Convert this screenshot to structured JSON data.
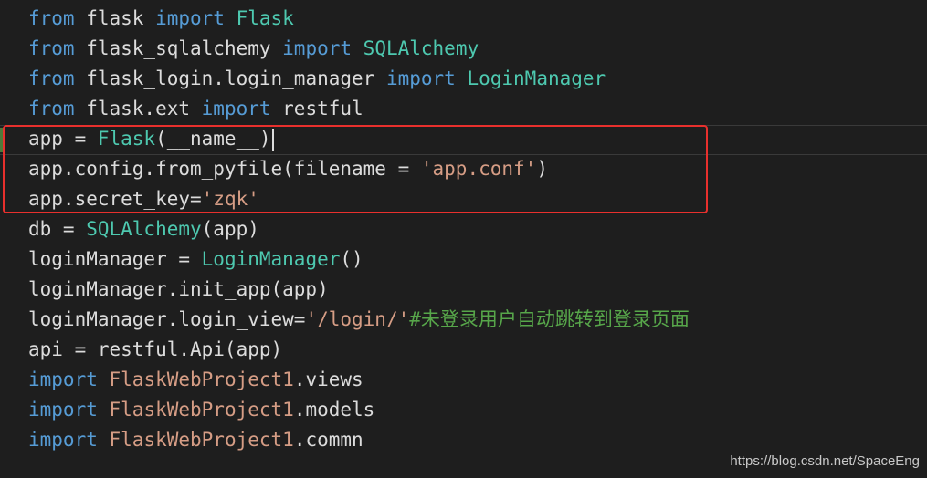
{
  "lines": [
    [
      {
        "t": "from",
        "c": "kw"
      },
      {
        "t": " flask ",
        "c": "plain"
      },
      {
        "t": "import",
        "c": "kw"
      },
      {
        "t": " ",
        "c": "plain"
      },
      {
        "t": "Flask",
        "c": "cls"
      }
    ],
    [
      {
        "t": "from",
        "c": "kw"
      },
      {
        "t": " flask_sqlalchemy ",
        "c": "plain"
      },
      {
        "t": "import",
        "c": "kw"
      },
      {
        "t": " ",
        "c": "plain"
      },
      {
        "t": "SQLAlchemy",
        "c": "cls"
      }
    ],
    [
      {
        "t": "from",
        "c": "kw"
      },
      {
        "t": " flask_login.login_manager ",
        "c": "plain"
      },
      {
        "t": "import",
        "c": "kw"
      },
      {
        "t": " ",
        "c": "plain"
      },
      {
        "t": "LoginManager",
        "c": "cls"
      }
    ],
    [
      {
        "t": "from",
        "c": "kw"
      },
      {
        "t": " flask.ext ",
        "c": "plain"
      },
      {
        "t": "import",
        "c": "kw"
      },
      {
        "t": " restful",
        "c": "plain"
      }
    ],
    [
      {
        "t": "app = ",
        "c": "plain"
      },
      {
        "t": "Flask",
        "c": "cls"
      },
      {
        "t": "(__name__)",
        "c": "plain"
      }
    ],
    [
      {
        "t": "app.config.from_pyfile(filename = ",
        "c": "plain"
      },
      {
        "t": "'app.conf'",
        "c": "str"
      },
      {
        "t": ")",
        "c": "plain"
      }
    ],
    [
      {
        "t": "app.secret_key=",
        "c": "plain"
      },
      {
        "t": "'zqk'",
        "c": "str"
      }
    ],
    [
      {
        "t": "db = ",
        "c": "plain"
      },
      {
        "t": "SQLAlchemy",
        "c": "cls"
      },
      {
        "t": "(app)",
        "c": "plain"
      }
    ],
    [
      {
        "t": "loginManager = ",
        "c": "plain"
      },
      {
        "t": "LoginManager",
        "c": "cls"
      },
      {
        "t": "()",
        "c": "plain"
      }
    ],
    [
      {
        "t": "loginManager.init_app(app)",
        "c": "plain"
      }
    ],
    [
      {
        "t": "loginManager.login_view=",
        "c": "plain"
      },
      {
        "t": "'/login/'",
        "c": "str"
      },
      {
        "t": "#未登录用户自动跳转到登录页面",
        "c": "cmt"
      }
    ],
    [
      {
        "t": "api = restful.Api(app)",
        "c": "plain"
      }
    ],
    [
      {
        "t": "import",
        "c": "kw"
      },
      {
        "t": " ",
        "c": "plain"
      },
      {
        "t": "FlaskWebProject1",
        "c": "str"
      },
      {
        "t": ".views",
        "c": "plain"
      }
    ],
    [
      {
        "t": "import",
        "c": "kw"
      },
      {
        "t": " ",
        "c": "plain"
      },
      {
        "t": "FlaskWebProject1",
        "c": "str"
      },
      {
        "t": ".models",
        "c": "plain"
      }
    ],
    [
      {
        "t": "import",
        "c": "kw"
      },
      {
        "t": " ",
        "c": "plain"
      },
      {
        "t": "FlaskWebProject1",
        "c": "str"
      },
      {
        "t": ".commn",
        "c": "plain"
      }
    ]
  ],
  "cursor_line": 5,
  "watermark": "https://blog.csdn.net/SpaceEng",
  "colors": {
    "background": "#1e1e1e",
    "keyword": "#569cd6",
    "class": "#4ec9b0",
    "string": "#d69d85",
    "comment": "#57a64a",
    "text": "#dcdcdc",
    "highlight_box": "#e8302d"
  }
}
